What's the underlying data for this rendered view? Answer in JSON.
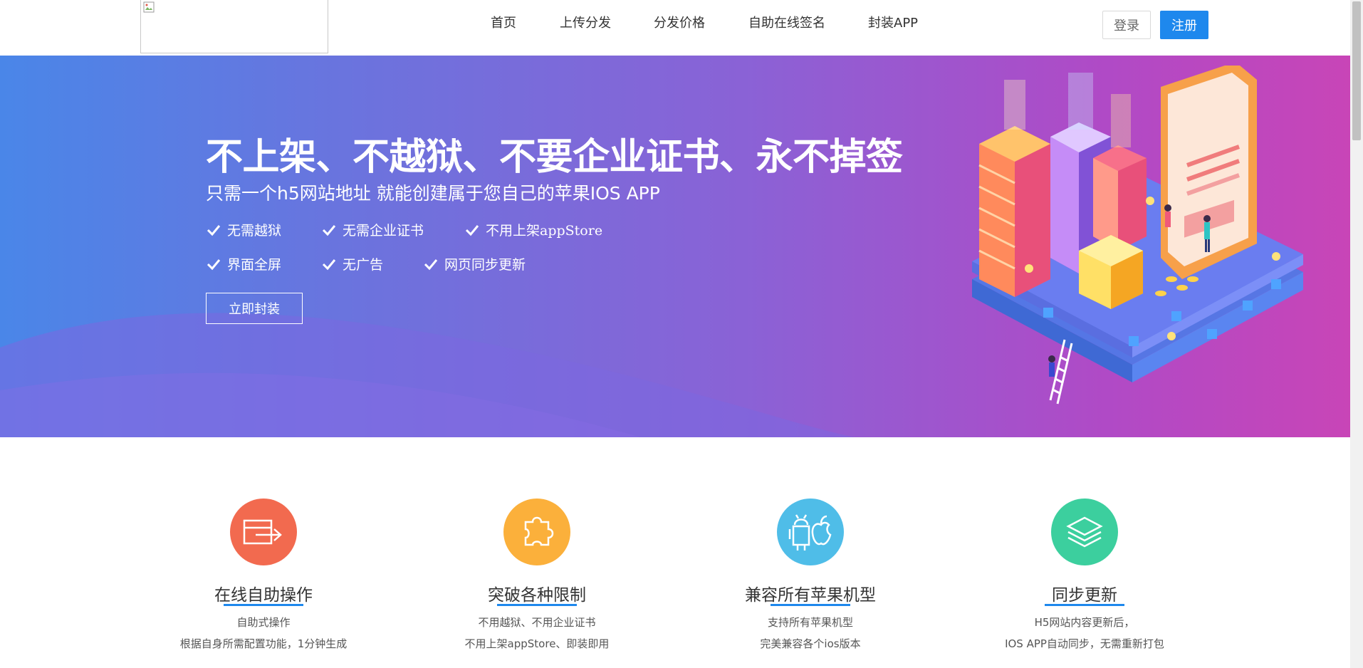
{
  "header": {
    "logo_alt": "",
    "nav": [
      {
        "label": "首页"
      },
      {
        "label": "上传分发"
      },
      {
        "label": "分发价格"
      },
      {
        "label": "自助在线签名"
      },
      {
        "label": "封装APP"
      }
    ],
    "login_label": "登录",
    "register_label": "注册",
    "accent_color": "#1e88ed"
  },
  "hero": {
    "title": "不上架、不越狱、不要企业证书、永不掉签",
    "subtitle": "只需一个h5网站地址 就能创建属于您自己的苹果IOS APP",
    "features_row1": [
      "无需越狱",
      "无需企业证书",
      "不用上架appStore"
    ],
    "features_row2": [
      "界面全屏",
      "无广告",
      "网页同步更新"
    ],
    "cta_label": "立即封装",
    "gradient": [
      "#4a86e8",
      "#c845b7"
    ]
  },
  "cards": [
    {
      "title": "在线自助操作",
      "lines": [
        "自助式操作",
        "根据自身所需配置功能，1分钟生成"
      ],
      "icon": "login-arrow-icon",
      "color": "#f26a4f"
    },
    {
      "title": "突破各种限制",
      "lines": [
        "不用越狱、不用企业证书",
        "不用上架appStore、即装即用"
      ],
      "icon": "puzzle-icon",
      "color": "#fbb03b"
    },
    {
      "title": "兼容所有苹果机型",
      "lines": [
        "支持所有苹果机型",
        "完美兼容各个ios版本"
      ],
      "icon": "android-apple-icon",
      "color": "#4fbde8"
    },
    {
      "title": "同步更新",
      "lines": [
        "H5网站内容更新后，",
        "IOS APP自动同步，无需重新打包"
      ],
      "icon": "layers-icon",
      "color": "#3ccf9e"
    }
  ]
}
